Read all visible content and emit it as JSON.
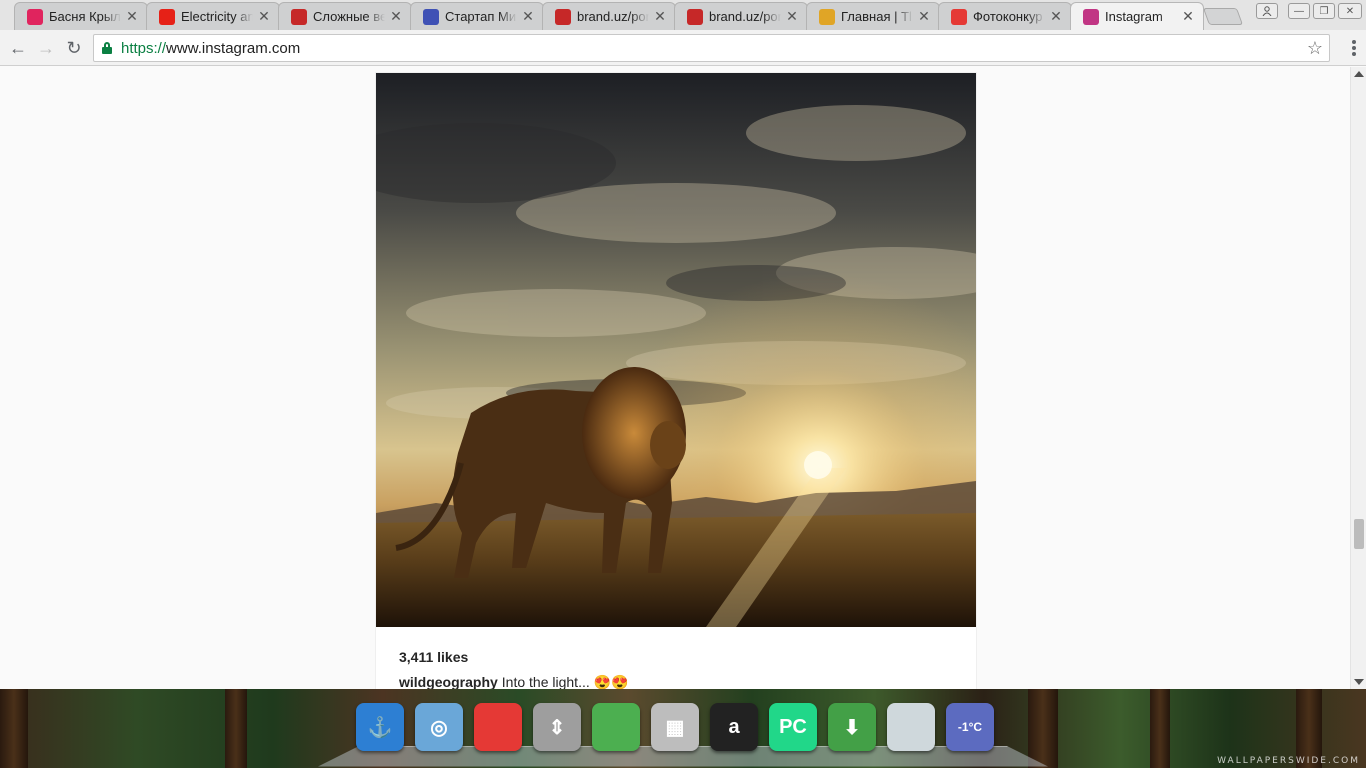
{
  "browser": {
    "tabs": [
      {
        "title": "Басня Крылов",
        "favicon": "heart-icon",
        "color": "#e0245e",
        "active": false
      },
      {
        "title": "Electricity and",
        "favicon": "youtube-icon",
        "color": "#e62117",
        "active": false
      },
      {
        "title": "Сложные ве",
        "favicon": "red-logo-icon",
        "color": "#c62828",
        "active": false
      },
      {
        "title": "Стартап Ми",
        "favicon": "sailboat-icon",
        "color": "#3f51b5",
        "active": false
      },
      {
        "title": "brand.uz/por",
        "favicon": "red-logo-icon",
        "color": "#c62828",
        "active": false
      },
      {
        "title": "brand.uz/por",
        "favicon": "red-logo-icon",
        "color": "#c62828",
        "active": false
      },
      {
        "title": "Главная | Tl",
        "favicon": "coin-icon",
        "color": "#e0a526",
        "active": false
      },
      {
        "title": "Фотоконкур",
        "favicon": "k-logo-icon",
        "color": "#e53935",
        "active": false
      },
      {
        "title": "Instagram",
        "favicon": "instagram-icon",
        "color": "#c13584",
        "active": true
      }
    ],
    "url": {
      "scheme": "https://",
      "host": "www.instagram.com"
    }
  },
  "post": {
    "likes": "3,411 likes",
    "username": "wildgeography",
    "caption": "Into the light... 😍😍"
  },
  "dock": {
    "items": [
      {
        "name": "anchor-app-icon",
        "glyph": "⚓",
        "color": "#2d7fd3"
      },
      {
        "name": "swirl-app-icon",
        "glyph": "◎",
        "color": "#6aa7d8"
      },
      {
        "name": "blocks-app-icon",
        "glyph": "",
        "color": "#e53935"
      },
      {
        "name": "arrows-app-icon",
        "glyph": "⇕",
        "color": "#9e9e9e"
      },
      {
        "name": "chrome-app-icon",
        "glyph": "",
        "color": "#4caf50"
      },
      {
        "name": "calculator-app-icon",
        "glyph": "▦",
        "color": "#bdbdbd"
      },
      {
        "name": "amazon-app-icon",
        "glyph": "a",
        "color": "#222222"
      },
      {
        "name": "pycharm-app-icon",
        "glyph": "PC",
        "color": "#21d789"
      },
      {
        "name": "download-app-icon",
        "glyph": "⬇",
        "color": "#43a047"
      },
      {
        "name": "trash-app-icon",
        "glyph": "",
        "color": "#cfd8dc"
      },
      {
        "name": "weather-app-icon",
        "glyph": "-1°C",
        "color": "#5c6bc0"
      }
    ]
  },
  "watermark": "WALLPAPERSWIDE.COM"
}
